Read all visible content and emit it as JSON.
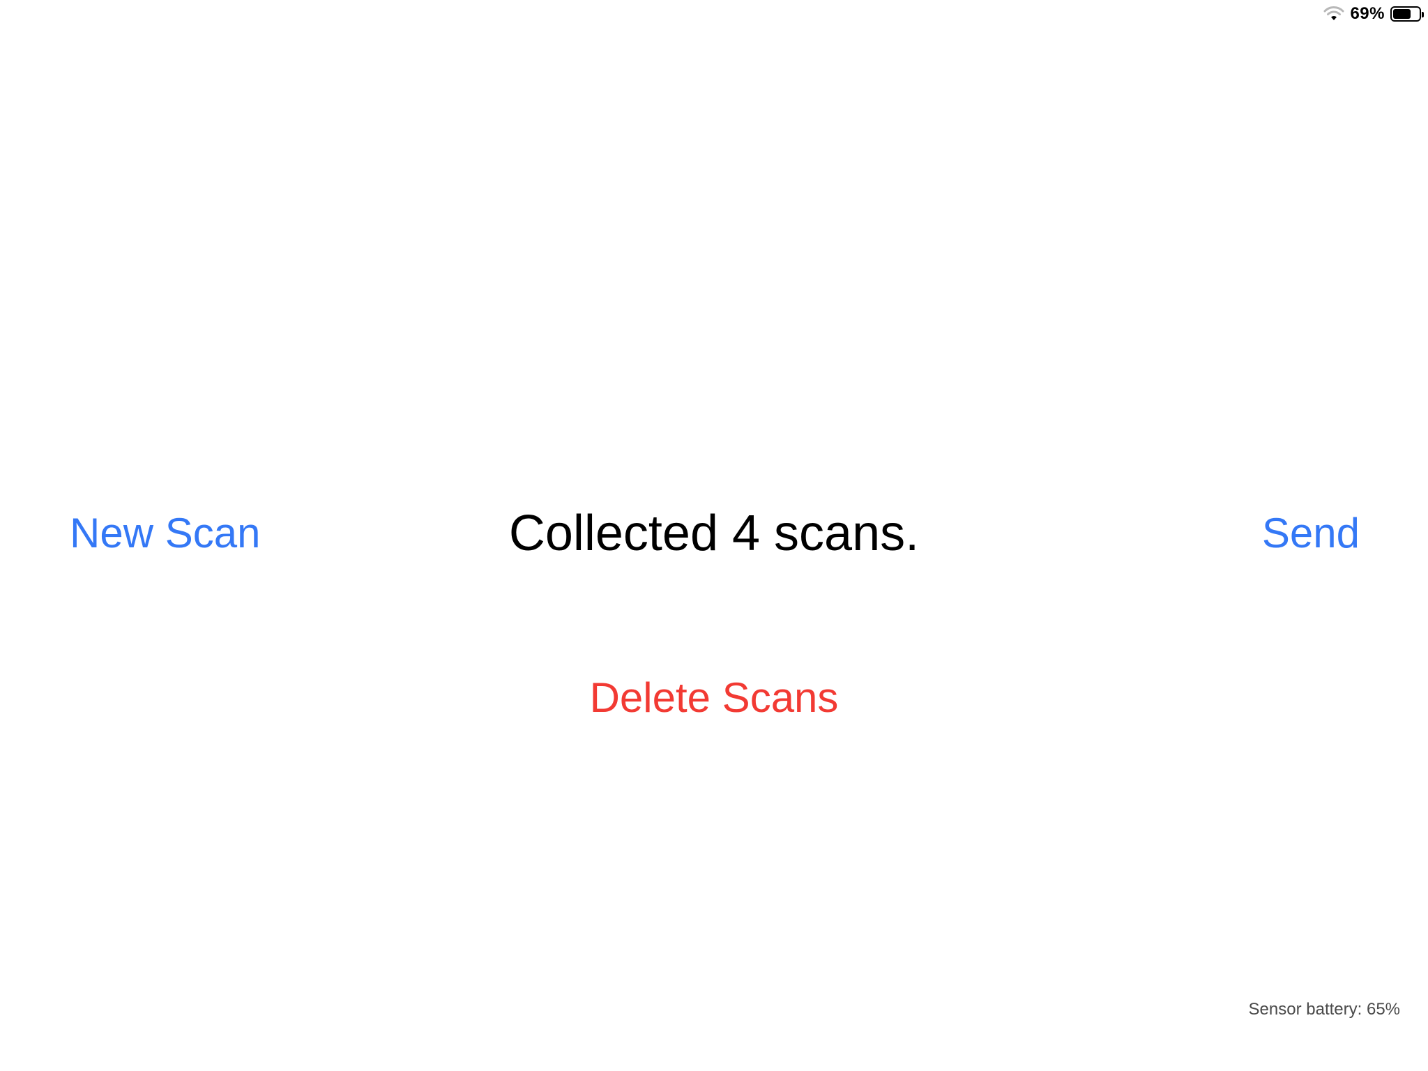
{
  "status_bar": {
    "wifi_icon": "wifi-icon",
    "battery_percent": "69%",
    "battery_level": 0.69,
    "battery_icon": "battery-icon"
  },
  "main": {
    "new_scan_label": "New Scan",
    "status_text": "Collected 4 scans.",
    "send_label": "Send",
    "delete_label": "Delete Scans"
  },
  "footer": {
    "sensor_battery_text": "Sensor battery: 65%"
  },
  "colors": {
    "accent": "#3478f6",
    "destructive": "#f23a33",
    "text": "#000000",
    "secondary_text": "#4a4a4a",
    "background": "#ffffff"
  }
}
